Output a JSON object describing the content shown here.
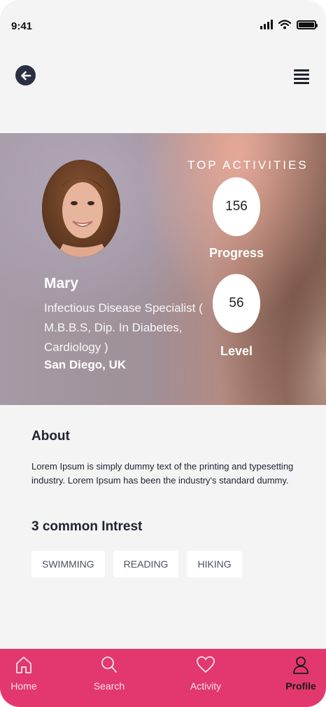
{
  "status_bar": {
    "time": "9:41"
  },
  "profile": {
    "name": "Mary",
    "specialty": "Infectious Disease Specialist ( M.B.B.S, Dip. In Diabetes, Cardiology )",
    "location": "San Diego, UK"
  },
  "activities": {
    "title": "TOP ACTIVITIES",
    "progress_value": "156",
    "progress_label": "Progress",
    "level_value": "56",
    "level_label": "Level"
  },
  "about": {
    "title": "About",
    "text": "Lorem Ipsum is simply dummy text of the printing and typesetting industry. Lorem Ipsum has been the industry's standard dummy."
  },
  "interests": {
    "title": "3 common Intrest",
    "items": [
      "SWIMMING",
      "READING",
      "HIKING"
    ]
  },
  "tabbar": {
    "home": "Home",
    "search": "Search",
    "activity": "Activity",
    "profile": "Profile",
    "active": "profile"
  },
  "colors": {
    "accent": "#e2386e",
    "dark": "#2b3040",
    "background": "#f4f4f4"
  },
  "icons": [
    "back-arrow-icon",
    "menu-icon",
    "home-icon",
    "search-icon",
    "heart-icon",
    "user-icon"
  ]
}
